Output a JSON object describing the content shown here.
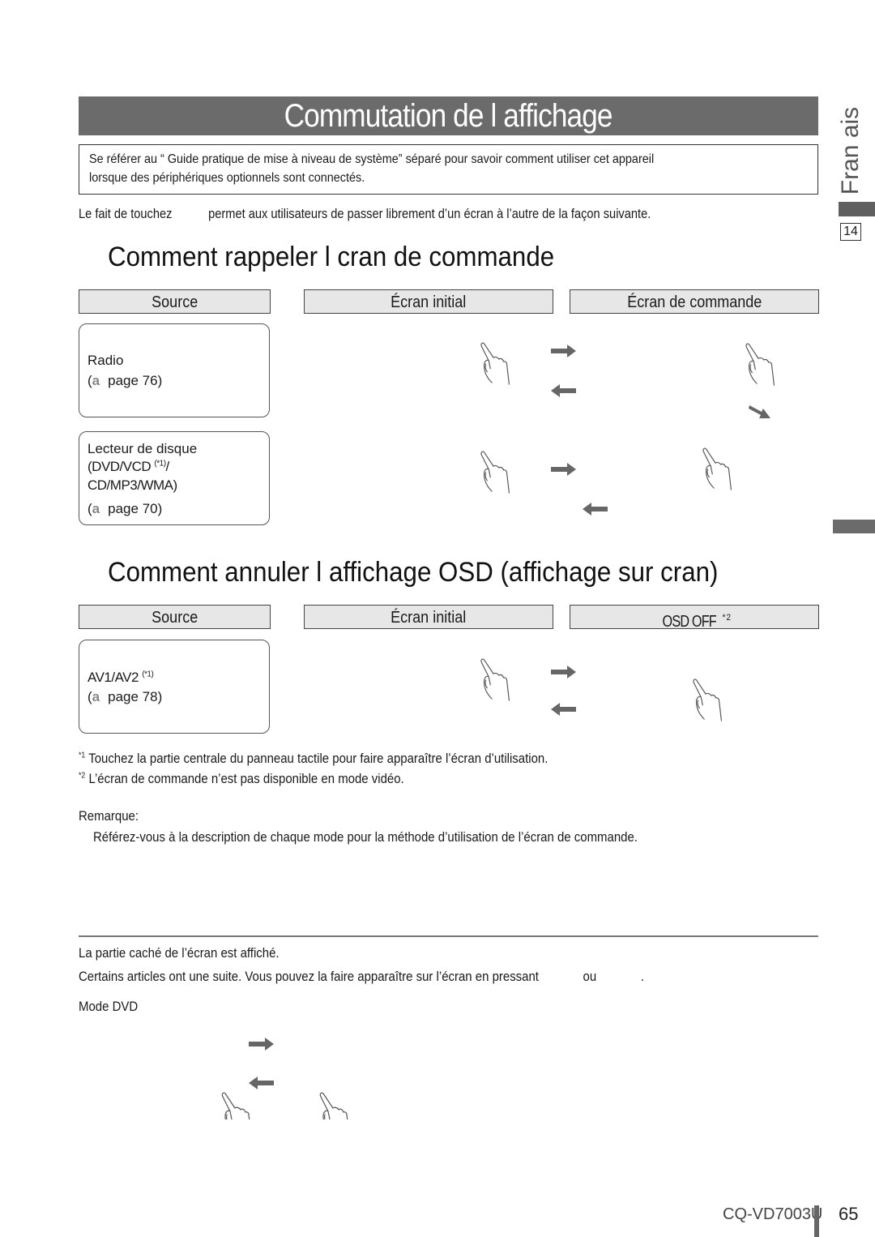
{
  "page": {
    "title": "Commutation de l affichage",
    "language_tab": "Fran ais",
    "chapter_number": "14",
    "model": "CQ-VD7003U",
    "page_number": "65"
  },
  "info_box": {
    "line1": "Se référer au “ Guide pratique de mise à niveau de système” séparé pour savoir comment utiliser cet appareil",
    "line2": "lorsque des périphériques optionnels sont connectés."
  },
  "intro": {
    "before": "Le fait de touchez",
    "after": "permet aux utilisateurs de passer librement d’un écran à l’autre de la façon suivante."
  },
  "section1": {
    "heading": "Comment rappeler l  cran de commande",
    "columns": [
      "Source",
      "Écran initial",
      "Écran de commande"
    ],
    "rows": [
      {
        "source": "Radio",
        "ref_glyph": "a",
        "ref": "page 76)",
        "ref_open": "("
      },
      {
        "source_l1": "Lecteur de disque",
        "source_l2": "(DVD/VCD",
        "source_l2_note": "(*1)",
        "source_l2_end": "/",
        "source_l3": "CD/MP3/WMA)",
        "ref_glyph": "a",
        "ref": "page 70)",
        "ref_open": "("
      }
    ]
  },
  "section2": {
    "heading": "Comment annuler l affichage OSD (affichage sur  cran)",
    "columns": [
      "Source",
      "Écran initial",
      "OSD OFF"
    ],
    "column3_note": "* 2",
    "rows": [
      {
        "source": "AV1/AV2",
        "source_note": "(*1)",
        "ref_glyph": "a",
        "ref": "page 78)",
        "ref_open": "("
      }
    ]
  },
  "footnotes": [
    {
      "mark": "*1",
      "text": "Touchez la partie centrale du panneau tactile pour faire apparaître l’écran d’utilisation."
    },
    {
      "mark": "*2",
      "text": "L’écran de commande n’est pas disponible en mode vidéo."
    }
  ],
  "remark": {
    "label": "Remarque:",
    "text": "Référez-vous à la description de chaque mode pour la méthode d’utilisation de l’écran de commande."
  },
  "hidden_part": {
    "heading": "La partie caché de l’écran est affiché.",
    "text_before": "Certains articles ont une suite. Vous pouvez la faire apparaître sur l’écran en pressant",
    "text_or": "ou",
    "text_end": ".",
    "mode": "Mode DVD"
  },
  "colors": {
    "title_bar": "#6b6b6b",
    "header_fill": "#e7e7e7",
    "arrow": "#666666"
  },
  "icons": {
    "hand": "touch-hand-icon",
    "arrow_right": "arrow-right-icon",
    "arrow_left": "arrow-left-icon",
    "arrow_diag": "arrow-down-right-icon",
    "page_ref": "page-reference-icon"
  }
}
